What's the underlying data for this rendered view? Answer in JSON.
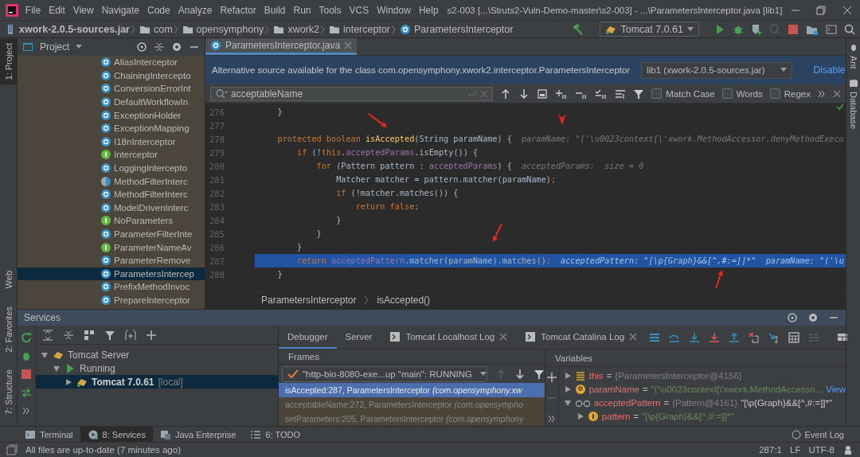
{
  "menu_bar": {
    "items": [
      "File",
      "Edit",
      "View",
      "Navigate",
      "Code",
      "Analyze",
      "Refactor",
      "Build",
      "Run",
      "Tools",
      "VCS",
      "Window",
      "Help"
    ],
    "title": "s2-003 [...\\Struts2-Vuln-Demo-master\\s2-003] - ...\\ParametersInterceptor.java [lib1]"
  },
  "nav_bar": {
    "path": [
      {
        "label": "xwork-2.0.5-sources.jar",
        "kind": "jar"
      },
      {
        "label": "com",
        "kind": "folder"
      },
      {
        "label": "opensymphony",
        "kind": "folder"
      },
      {
        "label": "xwork2",
        "kind": "folder"
      },
      {
        "label": "interceptor",
        "kind": "folder"
      },
      {
        "label": "ParametersInterceptor",
        "kind": "class"
      }
    ],
    "run_config": "Tomcat 7.0.61"
  },
  "left_tool_tabs": {
    "top": [
      {
        "label": "1: Project",
        "selected": true
      }
    ],
    "bottom": [
      {
        "label": "Web",
        "selected": false
      },
      {
        "label": "2: Favorites",
        "selected": false
      },
      {
        "label": "7: Structure",
        "selected": false
      }
    ]
  },
  "right_tool_tabs": [
    {
      "label": "Ant"
    },
    {
      "label": "Database"
    }
  ],
  "project": {
    "title": "Project",
    "items": [
      {
        "label": "AliasInterceptor",
        "kind": "class",
        "selected": false
      },
      {
        "label": "ChainingIntercepto",
        "kind": "class",
        "selected": false
      },
      {
        "label": "ConversionErrorInt",
        "kind": "class",
        "selected": false
      },
      {
        "label": "DefaultWorkflowIn",
        "kind": "class",
        "selected": false
      },
      {
        "label": "ExceptionHolder",
        "kind": "class",
        "selected": false
      },
      {
        "label": "ExceptionMapping",
        "kind": "class",
        "selected": false
      },
      {
        "label": "I18nInterceptor",
        "kind": "class",
        "selected": false
      },
      {
        "label": "Interceptor",
        "kind": "interface",
        "selected": false
      },
      {
        "label": "LoggingIntercepto",
        "kind": "class",
        "selected": false
      },
      {
        "label": "MethodFilterInterc",
        "kind": "abstract",
        "selected": false
      },
      {
        "label": "MethodFilterInterc",
        "kind": "class",
        "selected": false
      },
      {
        "label": "ModelDrivenInterc",
        "kind": "class",
        "selected": false
      },
      {
        "label": "NoParameters",
        "kind": "interface",
        "selected": false
      },
      {
        "label": "ParameterFilterInte",
        "kind": "class",
        "selected": false
      },
      {
        "label": "ParameterNameAv",
        "kind": "interface",
        "selected": false
      },
      {
        "label": "ParameterRemove",
        "kind": "class",
        "selected": false
      },
      {
        "label": "ParametersIntercep",
        "kind": "class",
        "selected": true
      },
      {
        "label": "PrefixMethodInvoc",
        "kind": "class",
        "selected": false
      },
      {
        "label": "PrepareInterceptor",
        "kind": "class",
        "selected": false
      }
    ]
  },
  "editor": {
    "tab": "ParametersInterceptor.java",
    "banner": {
      "message": "Alternative source available for the class com.opensymphony.xwork2.interceptor.ParametersInterceptor",
      "source": "lib1 (xwork-2.0.5-sources.jar)",
      "action": "Disable"
    },
    "search": {
      "value": "acceptableName",
      "options": [
        {
          "label": "Match Case",
          "checked": false
        },
        {
          "label": "Words",
          "checked": false
        },
        {
          "label": "Regex",
          "checked": false
        }
      ]
    },
    "lines": [
      {
        "number": "276",
        "current": false,
        "segments": [
          {
            "text": "    }",
            "kind": "plain"
          }
        ]
      },
      {
        "number": "277",
        "current": false
      },
      {
        "number": "278",
        "current": false,
        "segments": [
          {
            "text": "    protected boolean ",
            "kind": "keyword"
          },
          {
            "text": "isAccepted",
            "kind": "method"
          },
          {
            "text": "(String paramName) {",
            "kind": "plain"
          }
        ],
        "hint": "paramName: \"('\\u0023context[\\'xwork.MethodAccessor.denyMethodExecu"
      },
      {
        "number": "279",
        "current": false,
        "segments": [
          {
            "text": "        if ",
            "kind": "keyword"
          },
          {
            "text": "(!",
            "kind": "plain"
          },
          {
            "text": "this",
            "kind": "keyword"
          },
          {
            "text": ".",
            "kind": "plain"
          },
          {
            "text": "acceptedParams",
            "kind": "field"
          },
          {
            "text": ".isEmpty()) {",
            "kind": "plain"
          }
        ]
      },
      {
        "number": "280",
        "current": false,
        "segments": [
          {
            "text": "            for ",
            "kind": "keyword"
          },
          {
            "text": "(Pattern pattern : ",
            "kind": "plain"
          },
          {
            "text": "acceptedParams",
            "kind": "field"
          },
          {
            "text": ") {",
            "kind": "plain"
          }
        ],
        "hint": "acceptedParams:  size = 0"
      },
      {
        "number": "281",
        "current": false,
        "segments": [
          {
            "text": "                Matcher matcher = pattern.matcher(paramName)",
            "kind": "plain"
          },
          {
            "text": ";",
            "kind": "keyword"
          }
        ]
      },
      {
        "number": "282",
        "current": false,
        "segments": [
          {
            "text": "                if ",
            "kind": "keyword"
          },
          {
            "text": "(!matcher.matches()) {",
            "kind": "plain"
          }
        ]
      },
      {
        "number": "283",
        "current": false,
        "segments": [
          {
            "text": "                    return false;",
            "kind": "keyword"
          }
        ]
      },
      {
        "number": "284",
        "current": false,
        "segments": [
          {
            "text": "                }",
            "kind": "plain"
          }
        ]
      },
      {
        "number": "285",
        "current": false,
        "segments": [
          {
            "text": "            }",
            "kind": "plain"
          }
        ]
      },
      {
        "number": "286",
        "current": false,
        "segments": [
          {
            "text": "        }",
            "kind": "plain"
          }
        ]
      },
      {
        "number": "287",
        "current": true,
        "segments": [
          {
            "text": "        return ",
            "kind": "keyword"
          },
          {
            "text": "acceptedPattern",
            "kind": "field"
          },
          {
            "text": ".matcher(paramName).matches()",
            "kind": "plain"
          },
          {
            "text": ";",
            "kind": "keyword"
          }
        ],
        "hint": "acceptedPattern: \"[\\p{Graph}&&[^,#:=]]*\"  paramName: \"('\\u"
      },
      {
        "number": "288",
        "current": false,
        "segments": [
          {
            "text": "    }",
            "kind": "plain"
          }
        ]
      }
    ],
    "annotations": [
      {
        "kind": "arrow"
      },
      {
        "kind": "arrowhead"
      },
      {
        "kind": "arrow"
      },
      {
        "kind": "arrow"
      }
    ],
    "breadcrumb": [
      "ParametersInterceptor",
      "isAccepted()"
    ]
  },
  "services": {
    "title": "Services",
    "tree": [
      {
        "label": "Tomcat Server",
        "kind": "server",
        "expanded": true,
        "selected": false,
        "children": [
          {
            "label": "Running",
            "kind": "status",
            "expanded": true,
            "selected": false,
            "children": [
              {
                "label": "Tomcat 7.0.61",
                "suffix": "[local]",
                "kind": "instance",
                "expanded": false,
                "selected": true
              }
            ]
          }
        ]
      }
    ],
    "tabs": [
      {
        "label": "Debugger",
        "kind": "plain",
        "selected": true
      },
      {
        "label": "Server",
        "kind": "plain",
        "selected": false
      },
      {
        "label": "Tomcat Localhost Log",
        "kind": "log",
        "selected": false
      },
      {
        "label": "Tomcat Catalina Log",
        "kind": "log",
        "selected": false
      }
    ],
    "frames": {
      "title": "Frames",
      "thread": "\"http-bio-8080-exe...up \"main\": RUNNING",
      "items": [
        {
          "text": "isAccepted:287, ParametersInterceptor *(com.opensymphony.xw*",
          "selected": true,
          "library": false
        },
        {
          "text": "acceptableName:272, ParametersInterceptor *(com.opensympho*",
          "selected": false,
          "library": true
        },
        {
          "text": "setParameters:205, ParametersInterceptor *(com.opensymphony*",
          "selected": false,
          "library": true
        }
      ]
    },
    "variables": {
      "title": "Variables",
      "items": [
        {
          "name": "this",
          "kind": "object",
          "expanded": false,
          "operator": "=",
          "ref": "{ParametersInterceptor@4156}"
        },
        {
          "name": "paramName",
          "kind": "param",
          "expanded": false,
          "operator": "=",
          "string_value": "\"('\\u0023context[\\'xwork.MethodAccesso...",
          "link": "View"
        },
        {
          "name": "acceptedPattern",
          "kind": "watch",
          "expanded": true,
          "operator": "=",
          "ref": "{Pattern@4161}",
          "value": "\"[\\p{Graph}&&[^,#:=]]*\"",
          "children": [
            {
              "name": "pattern",
              "kind": "field",
              "expanded": false,
              "operator": "=",
              "string_value": "\"[\\p{Graph}&&[^,#:=]]*\""
            }
          ]
        }
      ]
    }
  },
  "bottom_tabs": [
    {
      "label": "Terminal",
      "kind": "terminal",
      "selected": false
    },
    {
      "label": "8: Services",
      "kind": "services",
      "selected": true
    },
    {
      "label": "Java Enterprise",
      "kind": "enterprise",
      "selected": false
    },
    {
      "label": "6: TODO",
      "kind": "todo",
      "selected": false
    }
  ],
  "event_log": "Event Log",
  "status_bar": {
    "message": "All files are up-to-date (7 minutes ago)",
    "position": "287:1",
    "line_separator": "LF",
    "encoding": "UTF-8"
  }
}
